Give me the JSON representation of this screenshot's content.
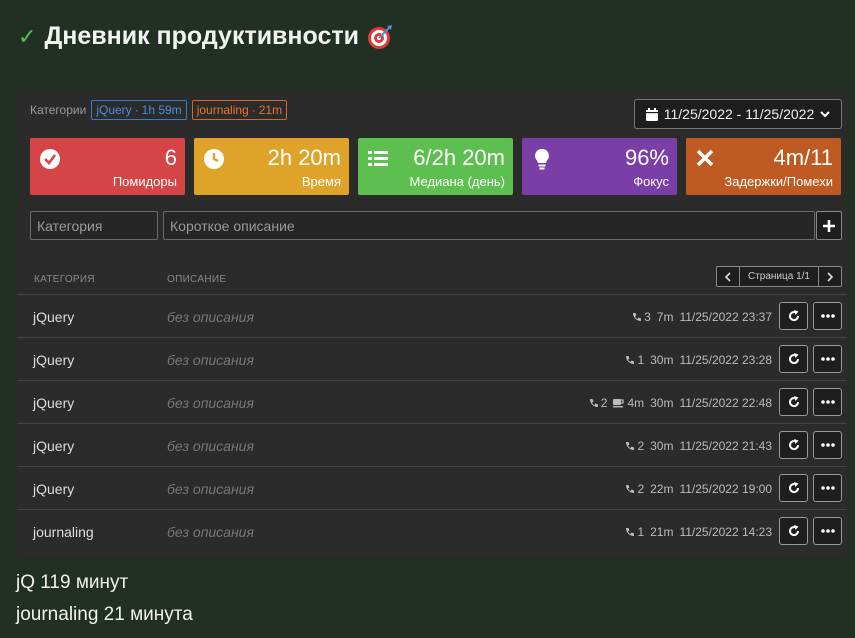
{
  "header": {
    "title": "Дневник продуктивности"
  },
  "categories": {
    "label": "Категории",
    "tags": [
      {
        "name": "jQuery",
        "time": "1h 59m"
      },
      {
        "name": "journaling",
        "time": "21m"
      }
    ]
  },
  "date_range": "11/25/2022 - 11/25/2022",
  "cards": [
    {
      "value": "6",
      "label": "Помидоры",
      "icon": "check-circle-icon",
      "color": "#d64545"
    },
    {
      "value": "2h 20m",
      "label": "Время",
      "icon": "clock-icon",
      "color": "#e0a32a"
    },
    {
      "value": "6/2h 20m",
      "label": "Медиана (день)",
      "icon": "list-icon",
      "color": "#5cbf4f"
    },
    {
      "value": "96%",
      "label": "Фокус",
      "icon": "lightbulb-icon",
      "color": "#7a3fa6"
    },
    {
      "value": "4m/11",
      "label": "Задержки/Помехи",
      "icon": "x-icon",
      "color": "#bf5a22"
    }
  ],
  "form": {
    "category_placeholder": "Категория",
    "description_placeholder": "Короткое описание"
  },
  "table": {
    "col_category": "КАТЕГОРИЯ",
    "col_description": "ОПИСАНИЕ",
    "pager_label": "Страница 1/1",
    "rows": [
      {
        "category": "jQuery",
        "description": "без описания",
        "calls": "3",
        "break": "",
        "duration": "7m",
        "timestamp": "11/25/2022 23:37"
      },
      {
        "category": "jQuery",
        "description": "без описания",
        "calls": "1",
        "break": "",
        "duration": "30m",
        "timestamp": "11/25/2022 23:28"
      },
      {
        "category": "jQuery",
        "description": "без описания",
        "calls": "2",
        "break": "4m",
        "duration": "30m",
        "timestamp": "11/25/2022 22:48"
      },
      {
        "category": "jQuery",
        "description": "без описания",
        "calls": "2",
        "break": "",
        "duration": "30m",
        "timestamp": "11/25/2022 21:43"
      },
      {
        "category": "jQuery",
        "description": "без описания",
        "calls": "2",
        "break": "",
        "duration": "22m",
        "timestamp": "11/25/2022 19:00"
      },
      {
        "category": "journaling",
        "description": "без описания",
        "calls": "1",
        "break": "",
        "duration": "21m",
        "timestamp": "11/25/2022 14:23"
      }
    ]
  },
  "summary": [
    "jQ 119 минут",
    "journaling 21 минута"
  ]
}
